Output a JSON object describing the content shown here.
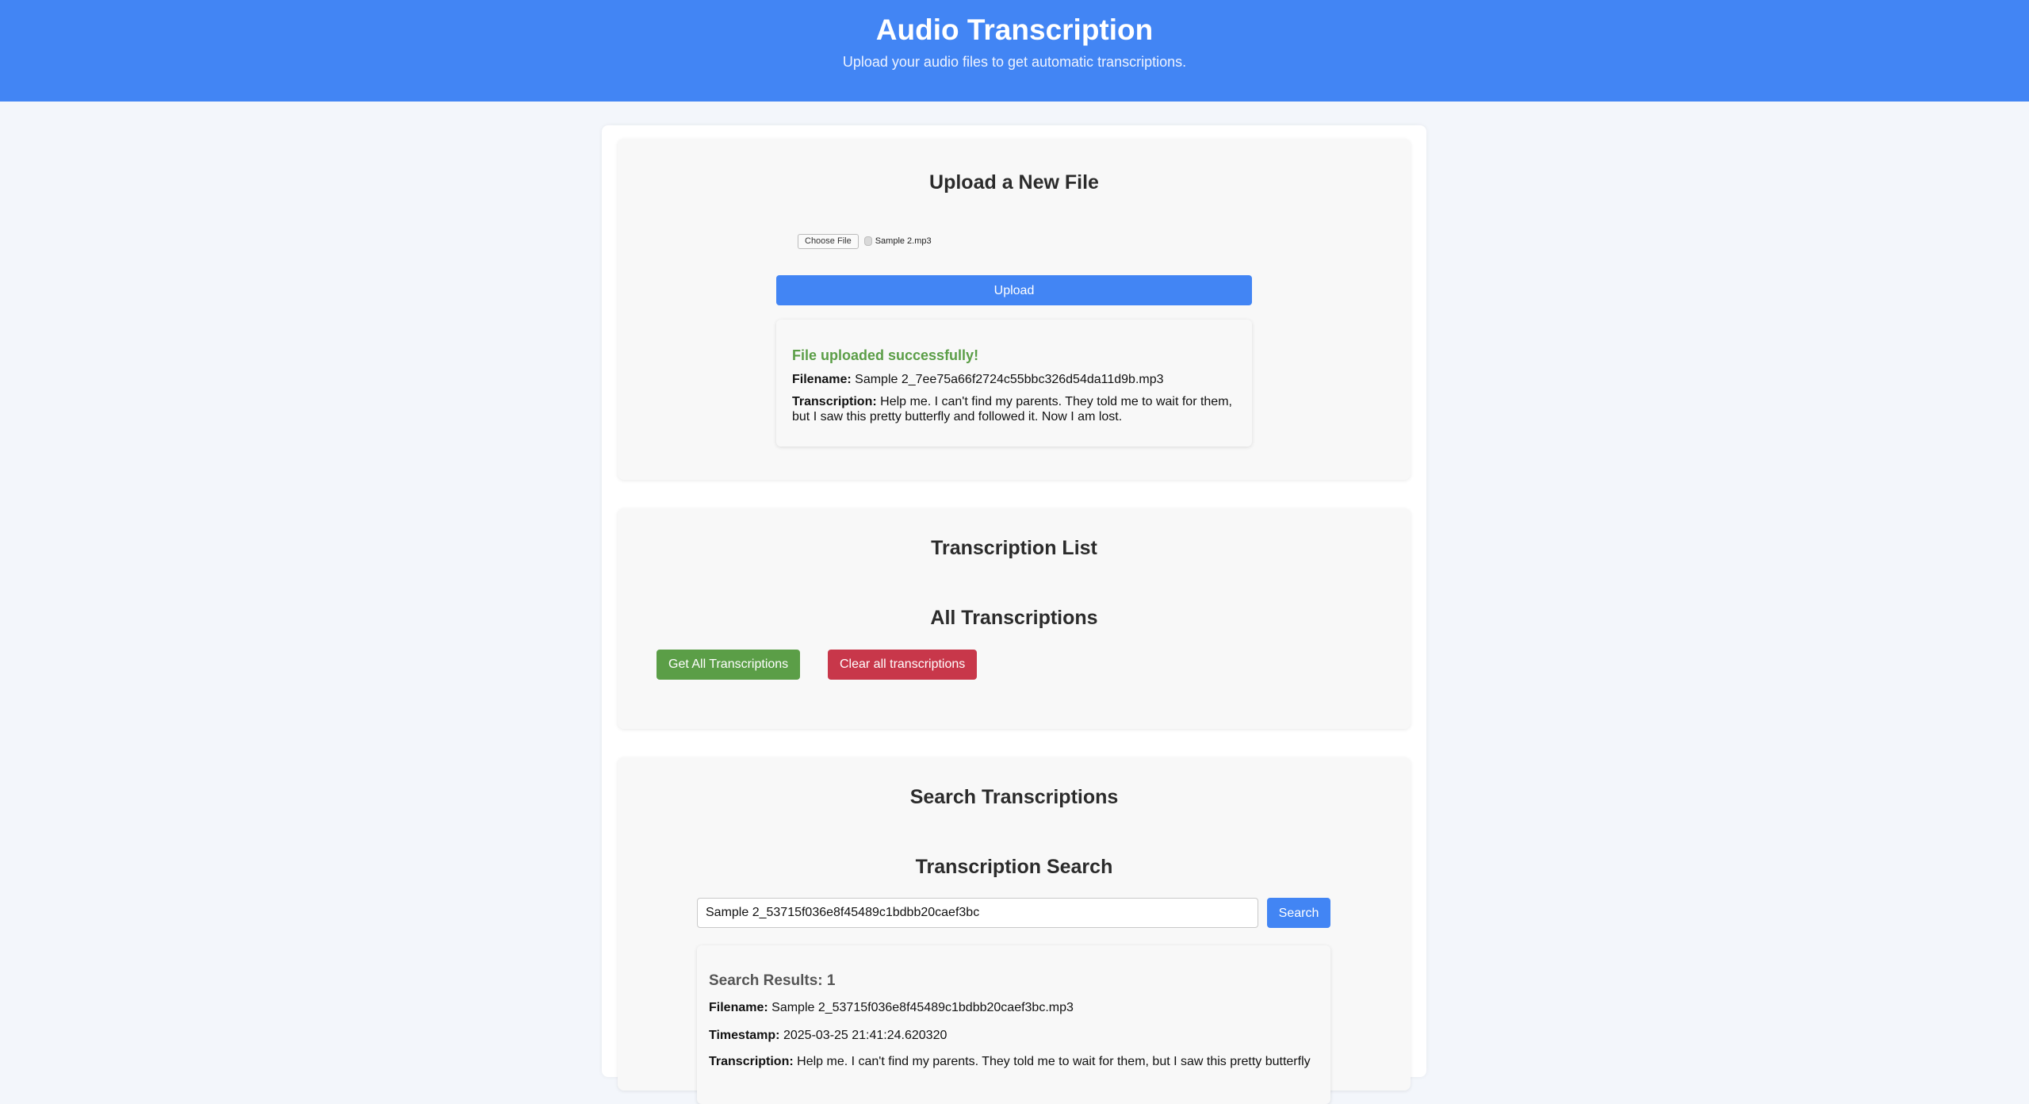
{
  "header": {
    "title": "Audio Transcription",
    "subtitle": "Upload your audio files to get automatic transcriptions."
  },
  "upload": {
    "heading": "Upload a New File",
    "choose_file_label": "Choose File",
    "selected_file": "Sample 2.mp3",
    "upload_button": "Upload",
    "result": {
      "status": "File uploaded successfully!",
      "filename_label": "Filename:",
      "filename": "Sample 2_7ee75a66f2724c55bbc326d54da11d9b.mp3",
      "transcription_label": "Transcription:",
      "transcription": "Help me. I can't find my parents. They told me to wait for them, but I saw this pretty butterfly and followed it. Now I am lost."
    }
  },
  "list": {
    "heading": "Transcription List",
    "subheading": "All Transcriptions",
    "get_all_button": "Get All Transcriptions",
    "clear_all_button": "Clear all transcriptions"
  },
  "search": {
    "heading": "Search Transcriptions",
    "subheading": "Transcription Search",
    "input_value": "Sample 2_53715f036e8f45489c1bdbb20caef3bc",
    "search_button": "Search",
    "results": {
      "count_text": "Search Results: 1",
      "filename_label": "Filename:",
      "filename": "Sample 2_53715f036e8f45489c1bdbb20caef3bc.mp3",
      "timestamp_label": "Timestamp:",
      "timestamp": "2025-03-25 21:41:24.620320",
      "transcription_label": "Transcription:",
      "transcription": "Help me. I can't find my parents. They told me to wait for them, but I saw this pretty butterfly"
    }
  },
  "colors": {
    "primary": "#4285f4",
    "success": "#5b9e47",
    "danger": "#c8374a"
  }
}
